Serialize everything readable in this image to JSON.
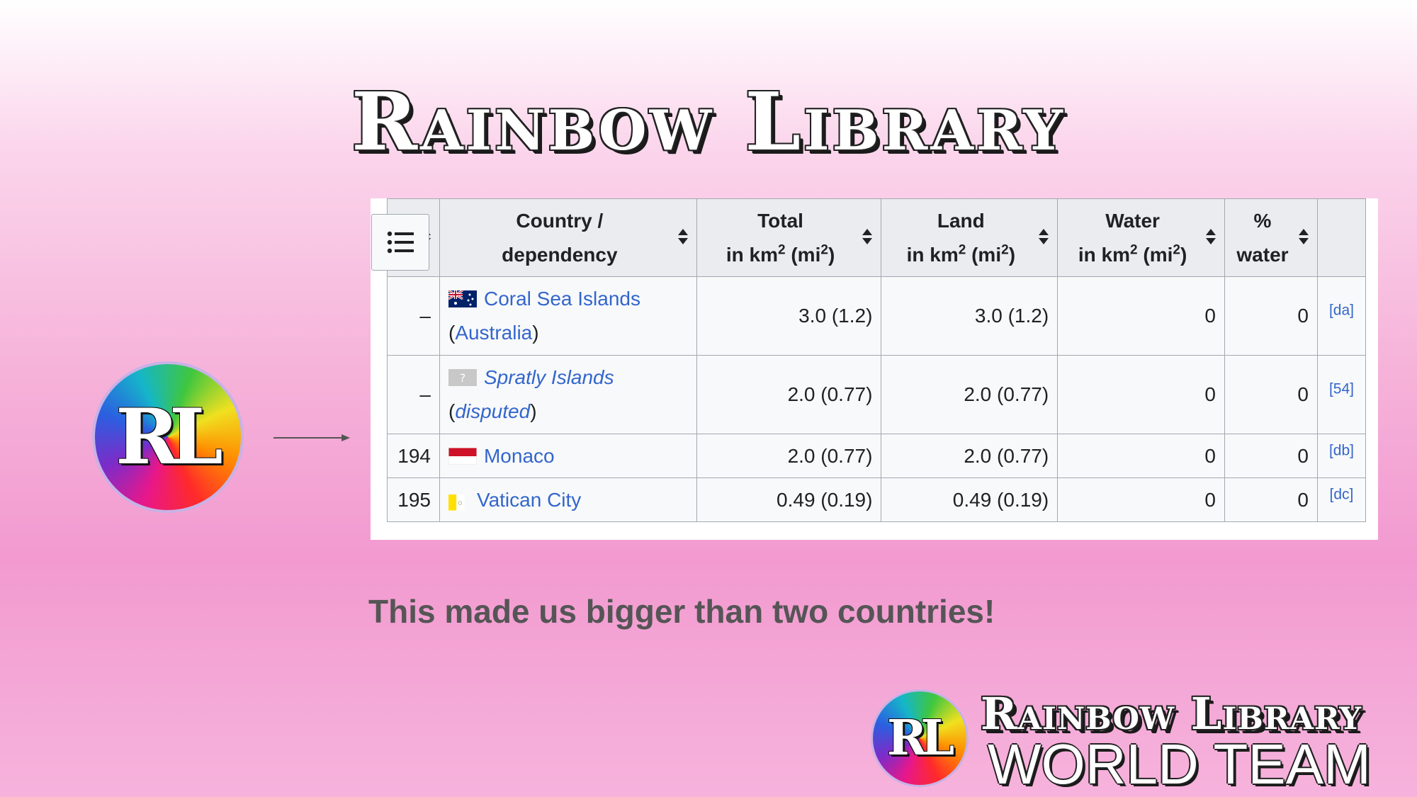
{
  "brand": {
    "title": "Rainbow Library",
    "logo_initials": "RL",
    "footer_title": "Rainbow Library",
    "footer_subtitle": "WORLD TEAM"
  },
  "table": {
    "headers": {
      "country": [
        "Country /",
        "dependency"
      ],
      "total": [
        "Total",
        "in km",
        "2",
        " (mi",
        "2",
        ")"
      ],
      "land": [
        "Land",
        "in km",
        "2",
        " (mi",
        "2",
        ")"
      ],
      "water": [
        "Water",
        "in km",
        "2",
        " (mi",
        "2",
        ")"
      ],
      "pct": [
        "%",
        "water"
      ]
    },
    "rows": [
      {
        "rank": "–",
        "name": "Coral Sea Islands",
        "sub_open": "(",
        "sub_link": "Australia",
        "sub_close": ")",
        "total": "3.0 (1.2)",
        "land": "3.0 (1.2)",
        "water": "0",
        "pct": "0",
        "ref": "[da]"
      },
      {
        "rank": "–",
        "name": "Spratly Islands",
        "sub_open": "(",
        "sub_link": "disputed",
        "sub_close": ")",
        "total": "2.0 (0.77)",
        "land": "2.0 (0.77)",
        "water": "0",
        "pct": "0",
        "ref": "[54]"
      },
      {
        "rank": "194",
        "name": "Monaco",
        "total": "2.0 (0.77)",
        "land": "2.0 (0.77)",
        "water": "0",
        "pct": "0",
        "ref": "[db]"
      },
      {
        "rank": "195",
        "name": "Vatican City",
        "total": "0.49 (0.19)",
        "land": "0.49 (0.19)",
        "water": "0",
        "pct": "0",
        "ref": "[dc]"
      }
    ]
  },
  "caption": "This made us bigger than two countries!",
  "colors": {
    "link": "#3366cc",
    "header_bg": "#eaecf0",
    "cell_bg": "#f8f9fa",
    "caption": "#555555"
  }
}
